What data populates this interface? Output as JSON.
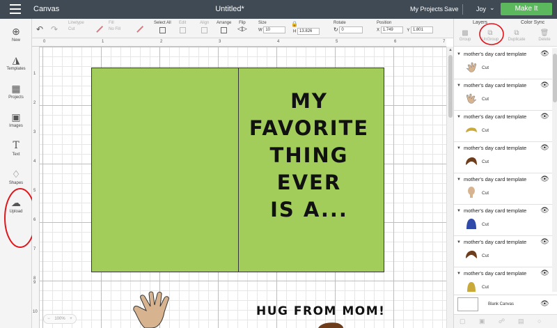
{
  "topbar": {
    "app_title": "Canvas",
    "document_title": "Untitled*",
    "my_projects": "My Projects",
    "save": "Save",
    "user": "Joy",
    "make_it": "Make It"
  },
  "toolbar": {
    "linetype_label": "Linetype",
    "linetype_value": "Cut",
    "fill_label": "Fill",
    "fill_value": "No Fill",
    "select_all": "Select All",
    "edit": "Edit",
    "align": "Align",
    "arrange": "Arrange",
    "flip": "Flip",
    "size_label": "Size",
    "size_w_label": "W",
    "size_w": "10",
    "size_h_label": "H",
    "size_h": "13.826",
    "rotate_label": "Rotate",
    "rotate": "0",
    "position_label": "Position",
    "pos_x_label": "X",
    "pos_x": "1.749",
    "pos_y_label": "Y",
    "pos_y": "1.801"
  },
  "leftbar": {
    "items": [
      {
        "label": "New",
        "icon": "plus-circle-icon"
      },
      {
        "label": "Templates",
        "icon": "tshirt-icon"
      },
      {
        "label": "Projects",
        "icon": "projects-icon"
      },
      {
        "label": "Images",
        "icon": "image-icon"
      },
      {
        "label": "Text",
        "icon": "text-t-icon"
      },
      {
        "label": "Shapes",
        "icon": "shapes-icon"
      },
      {
        "label": "Upload",
        "icon": "cloud-upload-icon"
      }
    ]
  },
  "rulers": {
    "top": [
      "0",
      "1",
      "2",
      "3",
      "4",
      "5",
      "6",
      "7"
    ],
    "left": [
      "1",
      "2",
      "3",
      "4",
      "5",
      "6",
      "7",
      "8",
      "9",
      "10"
    ]
  },
  "canvas": {
    "card_message": "MY\nFAVORITE\nTHING\nEVER\nIS A...",
    "card_color": "#a2cd5a",
    "hug_text": "HUG FROM MOM!",
    "zoom": "100%"
  },
  "panel": {
    "tabs": [
      "Layers",
      "Color Sync"
    ],
    "actions": [
      "Group",
      "UnGroup",
      "Duplicate",
      "Delete"
    ],
    "layers": [
      {
        "name": "mother's day card template",
        "op": "Cut",
        "thumb": "hand-icon",
        "color": "#d7b48f"
      },
      {
        "name": "mother's day card template",
        "op": "Cut",
        "thumb": "hand-icon",
        "color": "#d7b48f"
      },
      {
        "name": "mother's day card template",
        "op": "Cut",
        "thumb": "hair-icon",
        "color": "#c9a93a"
      },
      {
        "name": "mother's day card template",
        "op": "Cut",
        "thumb": "hair-icon",
        "color": "#6e3d1c"
      },
      {
        "name": "mother's day card template",
        "op": "Cut",
        "thumb": "head-icon",
        "color": "#d7b48f"
      },
      {
        "name": "mother's day card template",
        "op": "Cut",
        "thumb": "shirt-icon",
        "color": "#2f4aa8"
      },
      {
        "name": "mother's day card template",
        "op": "Cut",
        "thumb": "hair-icon",
        "color": "#6e3d1c"
      },
      {
        "name": "mother's day card template",
        "op": "Cut",
        "thumb": "hair-icon",
        "color": "#c9a93a"
      }
    ],
    "blank_canvas": "Blank Canvas"
  },
  "colors": {
    "topbar": "#3f4a55",
    "make_it": "#5cb85c",
    "annotation": "#e0151b"
  }
}
